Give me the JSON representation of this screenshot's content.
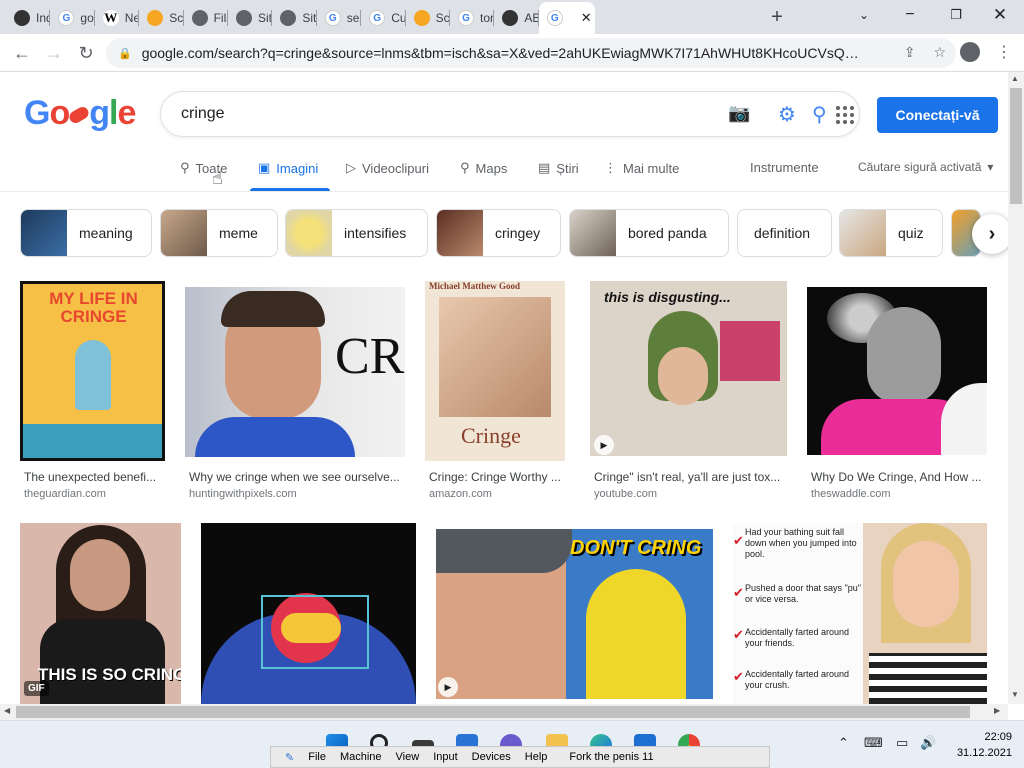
{
  "browser": {
    "tabs": [
      {
        "title": "Ind",
        "icon": "m"
      },
      {
        "title": "goo",
        "icon": "g"
      },
      {
        "title": "Ne",
        "icon": "w"
      },
      {
        "title": "Scr",
        "icon": "b"
      },
      {
        "title": "Filă",
        "icon": "c"
      },
      {
        "title": "Site",
        "icon": "c"
      },
      {
        "title": "Site",
        "icon": "c"
      },
      {
        "title": "sex",
        "icon": "g"
      },
      {
        "title": "Cu",
        "icon": "g"
      },
      {
        "title": "Scr",
        "icon": "b"
      },
      {
        "title": "ton",
        "icon": "g"
      },
      {
        "title": "ABC",
        "icon": "m"
      },
      {
        "title": "",
        "icon": "g"
      }
    ],
    "active_tab_index": 12,
    "url": "google.com/search?q=cringe&source=lnms&tbm=isch&sa=X&ved=2ahUKEwiagMWK7I71AhWHUt8KHcoUCVsQ_AU..."
  },
  "google": {
    "logo": "Google",
    "query": "cringe",
    "signin_label": "Conectați-vă",
    "tabs": [
      {
        "label": "Toate",
        "icon": "search-icon"
      },
      {
        "label": "Imagini",
        "icon": "image-icon"
      },
      {
        "label": "Videoclipuri",
        "icon": "video-icon"
      },
      {
        "label": "Maps",
        "icon": "map-pin-icon"
      },
      {
        "label": "Știri",
        "icon": "news-icon"
      },
      {
        "label": "Mai multe",
        "icon": "more-vert-icon"
      }
    ],
    "tools_label": "Instrumente",
    "safesearch_label": "Căutare sigură activată",
    "chips": [
      "meaning",
      "meme",
      "intensifies",
      "cringey",
      "bored panda",
      "definition",
      "quiz"
    ],
    "results_row1": [
      {
        "caption": "The unexpected benefi...",
        "source": "theguardian.com",
        "overlay": "MY LIFE IN CRINGE"
      },
      {
        "caption": "Why we cringe when we see ourselve...",
        "source": "huntingwithpixels.com",
        "overlay": "CRIN"
      },
      {
        "caption": "Cringe: Cringe Worthy ...",
        "source": "amazon.com",
        "overlay": "Cringe",
        "overlay_top": "Michael Matthew Good"
      },
      {
        "caption": "Cringe\" isn't real, ya'll are just tox...",
        "source": "youtube.com",
        "overlay": "this is disgusting..."
      },
      {
        "caption": "Why Do We Cringe, And How ...",
        "source": "theswaddle.com",
        "overlay": ""
      }
    ],
    "results_row2": [
      {
        "overlay": "THIS IS SO CRINGE",
        "badge": "GIF"
      },
      {
        "overlay": ""
      },
      {
        "overlay": "DON'T CRING"
      },
      {
        "overlay_lines": [
          "Had your bathing suit fall down when you jumped into pool.",
          "Pushed a door that says \"pu\" or vice versa.",
          "Accidentally farted around your friends.",
          "Accidentally farted around your crush."
        ]
      },
      {
        "overlay": ""
      }
    ]
  },
  "taskbar": {
    "vm_menu": [
      "File",
      "Machine",
      "View",
      "Input",
      "Devices",
      "Help"
    ],
    "vm_title": "Fork the penis 11",
    "time": "22:09",
    "date": "31.12.2021"
  }
}
